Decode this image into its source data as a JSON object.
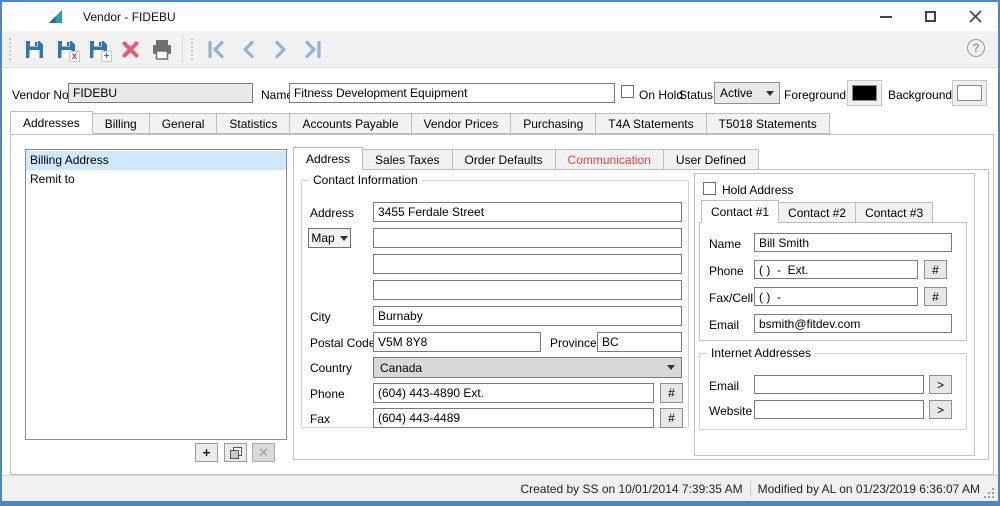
{
  "colors": {
    "window-border": "#4a86c8",
    "icon-blue": "#2f74b5",
    "nav-blue": "#8fb3d9",
    "delete-red": "#dd5f6d",
    "communication-red": "#e8443a",
    "selection-blue": "#cde8ff",
    "foreground-swatch": "#000000",
    "background-swatch": "#ffffff"
  },
  "window": {
    "title": "Vendor - FIDEBU"
  },
  "toolbar": {
    "help": "?",
    "icons": {
      "save": "floppy-disk",
      "save_close": "floppy-disk-with-red-x",
      "save_new": "floppy-disk-with-plus",
      "delete": "red-x",
      "print": "printer",
      "nav_first": "first-record",
      "nav_prev": "previous-record",
      "nav_next": "next-record",
      "nav_last": "last-record"
    }
  },
  "header": {
    "vendor_no_label": "Vendor No.",
    "vendor_no_value": "FIDEBU",
    "name_label": "Name",
    "name_value": "Fitness Development Equipment",
    "on_hold_label": "On Hold",
    "status_label": "Status",
    "status_value": "Active",
    "foreground_label": "Foreground",
    "background_label": "Background"
  },
  "main_tabs": {
    "active": "Addresses",
    "items": [
      "Addresses",
      "Billing",
      "General",
      "Statistics",
      "Accounts Payable",
      "Vendor Prices",
      "Purchasing",
      "T4A Statements",
      "T5018 Statements"
    ]
  },
  "address_list": {
    "selected": "Billing Address",
    "items": [
      "Billing Address",
      "Remit to"
    ],
    "add_label": "+",
    "delete_label": "✕"
  },
  "inner_tabs": {
    "active": "Address",
    "items": [
      "Address",
      "Sales Taxes",
      "Order Defaults",
      "Communication",
      "User Defined"
    ]
  },
  "contact_info": {
    "legend": "Contact Information",
    "address_label": "Address",
    "address_value": "3455 Ferdale Street",
    "address_line2": "",
    "address_line3": "",
    "address_line4": "",
    "map_label": "Map",
    "city_label": "City",
    "city_value": "Burnaby",
    "postal_code_label": "Postal Code",
    "postal_code_value": "V5M 8Y8",
    "province_label": "Province",
    "province_value": "BC",
    "country_label": "Country",
    "country_value": "Canada",
    "phone_label": "Phone",
    "phone_value": "(604) 443-4890 Ext.",
    "fax_label": "Fax",
    "fax_value": "(604) 443-4489",
    "hash_label": "#"
  },
  "contact_panel": {
    "hold_address_label": "Hold Address",
    "active_tab": "Contact #1",
    "tabs": [
      "Contact #1",
      "Contact #2",
      "Contact #3"
    ],
    "name_label": "Name",
    "name_value": "Bill Smith",
    "phone_label": "Phone",
    "phone_value": "( )  -  Ext.",
    "fax_label": "Fax/Cell",
    "fax_value": "( )  -",
    "email_label": "Email",
    "email_value": "bsmith@fitdev.com",
    "hash_label": "#"
  },
  "internet": {
    "legend": "Internet Addresses",
    "email_label": "Email",
    "email_value": "",
    "website_label": "Website",
    "website_value": "",
    "go_label": ">"
  },
  "status_bar": {
    "created": "Created by SS on 10/01/2014 7:39:35 AM",
    "modified": "Modified by AL on 01/23/2019 6:36:07 AM"
  }
}
